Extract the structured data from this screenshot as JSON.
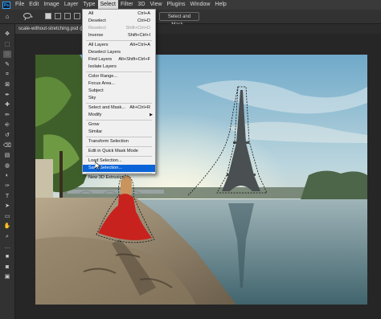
{
  "menubar": {
    "logo": "Ps",
    "items": [
      "File",
      "Edit",
      "Image",
      "Layer",
      "Type",
      "Select",
      "Filter",
      "3D",
      "View",
      "Plugins",
      "Window",
      "Help"
    ],
    "active_index": 5
  },
  "options_bar": {
    "select_and_mask_label": "Select and Mask...",
    "icons": [
      "home-icon",
      "lasso-icon",
      "new-selection-icon",
      "add-selection-icon",
      "subtract-selection-icon",
      "intersect-selection-icon"
    ]
  },
  "document_tab": {
    "title": "scale-without-stretching.psd @"
  },
  "select_menu": {
    "items": [
      {
        "label": "All",
        "shortcut": "Ctrl+A",
        "disabled": false
      },
      {
        "label": "Deselect",
        "shortcut": "Ctrl+D",
        "disabled": false
      },
      {
        "label": "Reselect",
        "shortcut": "Shift+Ctrl+D",
        "disabled": true
      },
      {
        "label": "Inverse",
        "shortcut": "Shift+Ctrl+I",
        "disabled": false
      },
      {
        "sep": true
      },
      {
        "label": "All Layers",
        "shortcut": "Alt+Ctrl+A",
        "disabled": false
      },
      {
        "label": "Deselect Layers",
        "shortcut": "",
        "disabled": false
      },
      {
        "label": "Find Layers",
        "shortcut": "Alt+Shift+Ctrl+F",
        "disabled": false
      },
      {
        "label": "Isolate Layers",
        "shortcut": "",
        "disabled": false
      },
      {
        "sep": true
      },
      {
        "label": "Color Range...",
        "shortcut": "",
        "disabled": false
      },
      {
        "label": "Focus Area...",
        "shortcut": "",
        "disabled": false
      },
      {
        "label": "Subject",
        "shortcut": "",
        "disabled": false
      },
      {
        "label": "Sky",
        "shortcut": "",
        "disabled": false
      },
      {
        "sep": true
      },
      {
        "label": "Select and Mask...",
        "shortcut": "Alt+Ctrl+R",
        "disabled": false
      },
      {
        "label": "Modify",
        "shortcut": "",
        "disabled": false,
        "submenu": true
      },
      {
        "sep": true
      },
      {
        "label": "Grow",
        "shortcut": "",
        "disabled": false
      },
      {
        "label": "Similar",
        "shortcut": "",
        "disabled": false
      },
      {
        "sep": true
      },
      {
        "label": "Transform Selection",
        "shortcut": "",
        "disabled": false
      },
      {
        "sep": true
      },
      {
        "label": "Edit in Quick Mask Mode",
        "shortcut": "",
        "disabled": false
      },
      {
        "sep": true
      },
      {
        "label": "Load Selection...",
        "shortcut": "",
        "disabled": false
      },
      {
        "label": "Save Selection...",
        "shortcut": "",
        "disabled": false,
        "highlight": true
      },
      {
        "sep": true
      },
      {
        "label": "New 3D Extrusion",
        "shortcut": "",
        "disabled": false
      }
    ]
  },
  "tools": [
    "move-tool-icon",
    "marquee-tool-icon",
    "lasso-tool-icon",
    "quick-select-tool-icon",
    "crop-tool-icon",
    "frame-tool-icon",
    "eyedropper-tool-icon",
    "healing-brush-tool-icon",
    "brush-tool-icon",
    "clone-stamp-tool-icon",
    "history-brush-tool-icon",
    "eraser-tool-icon",
    "gradient-tool-icon",
    "blur-tool-icon",
    "dodge-tool-icon",
    "pen-tool-icon",
    "type-tool-icon",
    "path-select-tool-icon",
    "rectangle-tool-icon",
    "hand-tool-icon",
    "zoom-tool-icon",
    "edit-toolbar-icon",
    "color-swatches-icon",
    "quick-mask-icon",
    "screen-mode-icon"
  ],
  "colors": {
    "menu_highlight": "#0a64d8",
    "selection_marching_ants": "#000000",
    "woman_dress": "#c8221e"
  }
}
